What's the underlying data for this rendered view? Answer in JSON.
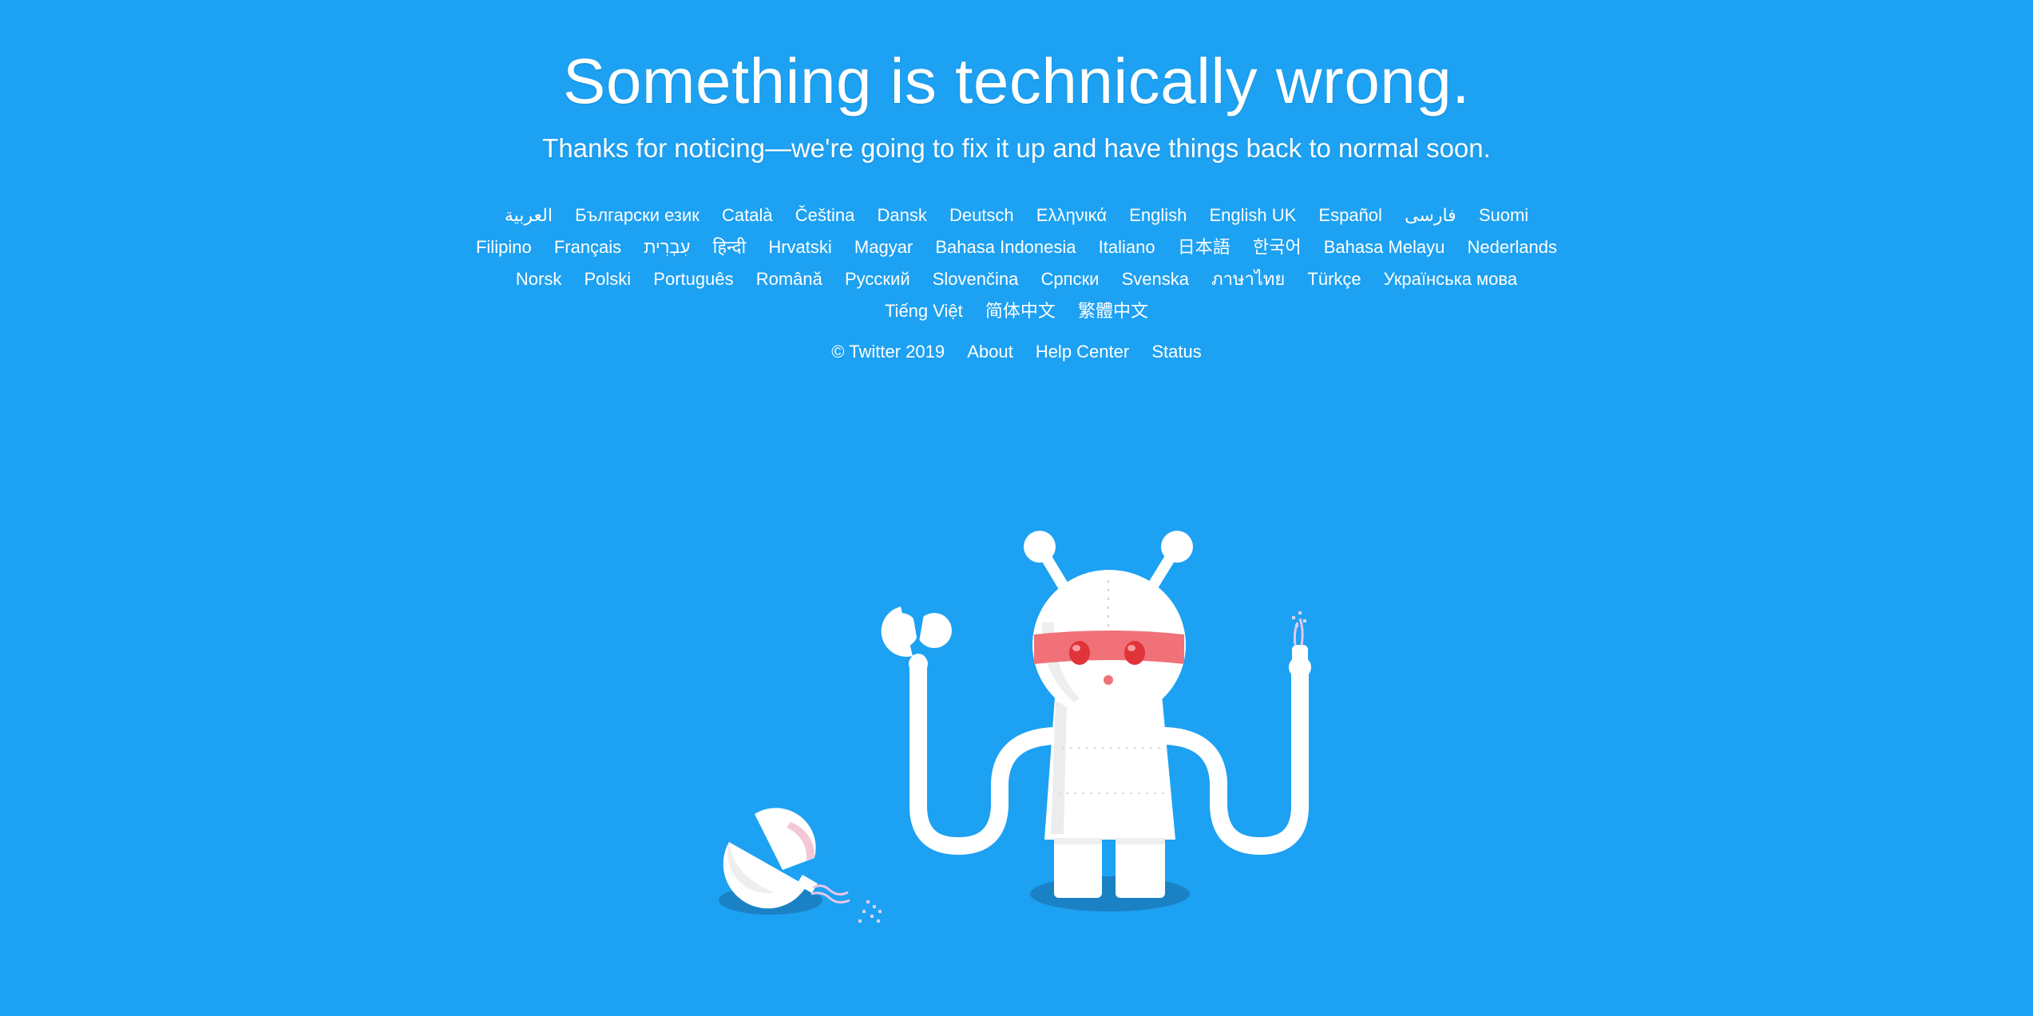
{
  "page": {
    "title": "Something is technically wrong.",
    "subtitle": "Thanks for noticing—we're going to fix it up and have things back to normal soon.",
    "background_color": "#1da1f2"
  },
  "languages": [
    {
      "label": "العربية",
      "dir": "rtl"
    },
    {
      "label": "Български език"
    },
    {
      "label": "Català"
    },
    {
      "label": "Čeština"
    },
    {
      "label": "Dansk"
    },
    {
      "label": "Deutsch"
    },
    {
      "label": "Ελληνικά"
    },
    {
      "label": "English"
    },
    {
      "label": "English UK"
    },
    {
      "label": "Español"
    },
    {
      "label": "فارسی",
      "dir": "rtl"
    },
    {
      "label": "Suomi"
    },
    {
      "label": "Filipino"
    },
    {
      "label": "Français"
    },
    {
      "label": "עִבְרִית",
      "dir": "rtl"
    },
    {
      "label": "हिन्दी"
    },
    {
      "label": "Hrvatski"
    },
    {
      "label": "Magyar"
    },
    {
      "label": "Bahasa Indonesia"
    },
    {
      "label": "Italiano"
    },
    {
      "label": "日本語"
    },
    {
      "label": "한국어"
    },
    {
      "label": "Bahasa Melayu"
    },
    {
      "label": "Nederlands"
    },
    {
      "label": "Norsk"
    },
    {
      "label": "Polski"
    },
    {
      "label": "Português"
    },
    {
      "label": "Română"
    },
    {
      "label": "Русский"
    },
    {
      "label": "Slovenčina"
    },
    {
      "label": "Српски"
    },
    {
      "label": "Svenska"
    },
    {
      "label": "ภาษาไทย"
    },
    {
      "label": "Türkçe"
    },
    {
      "label": "Українська мова"
    },
    {
      "label": "Tiếng Việt"
    },
    {
      "label": "简体中文"
    },
    {
      "label": "繁體中文"
    }
  ],
  "footer": {
    "copyright": "© Twitter 2019",
    "links": [
      {
        "label": "About"
      },
      {
        "label": "Help Center"
      },
      {
        "label": "Status"
      }
    ]
  },
  "illustration": {
    "name": "broken-robot-illustration",
    "body_color": "#ffffff",
    "band_color": "#f07178",
    "eye_color": "#e0333a",
    "shadow_color": "#1a82c4"
  }
}
